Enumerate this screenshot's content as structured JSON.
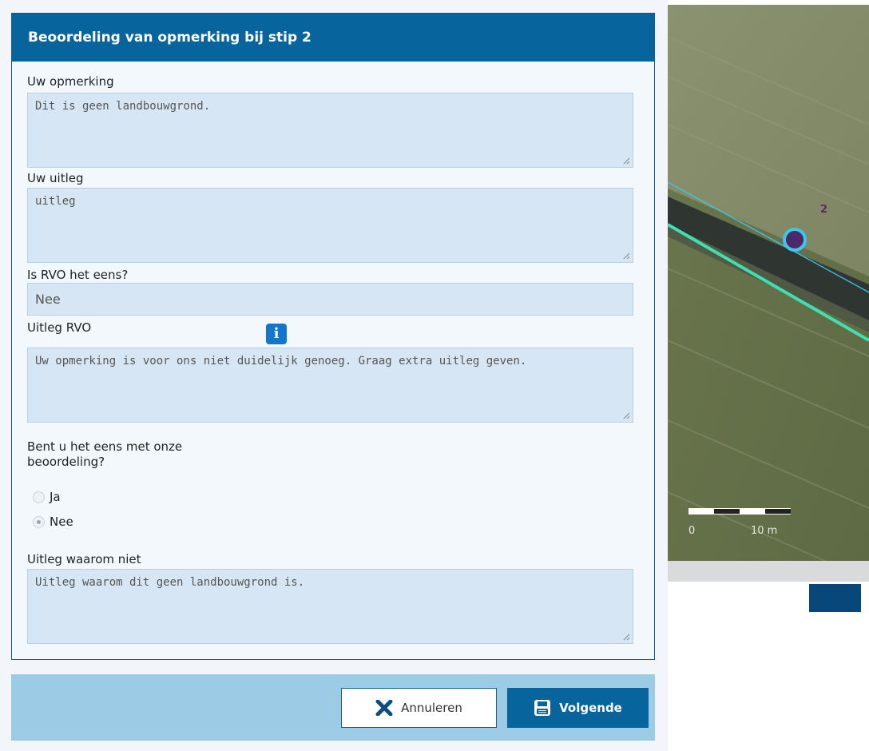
{
  "dialog": {
    "title": "Beoordeling van opmerking bij stip 2",
    "fields": {
      "remark_label": "Uw opmerking",
      "remark_value": "Dit is geen landbouwgrond.",
      "explanation_label": "Uw uitleg",
      "explanation_value": "uitleg",
      "agree_label": "Is RVO het eens?",
      "agree_value": "Nee",
      "rvo_explanation_label": "Uitleg RVO",
      "rvo_explanation_value": "Uw opmerking is voor ons niet duidelijk genoeg. Graag extra uitleg geven.",
      "question_line1": "Bent u het eens met onze",
      "question_line2": "beoordeling?",
      "why_not_label": "Uitleg waarom niet",
      "why_not_value": "Uitleg waarom dit geen landbouwgrond is."
    },
    "radio": {
      "options": [
        "Ja",
        "Nee"
      ],
      "selected": "Nee"
    },
    "info_icon_glyph": "i"
  },
  "footer": {
    "cancel_label": "Annuleren",
    "next_label": "Volgende"
  },
  "map": {
    "marker_label": "2",
    "scale_start": "0",
    "scale_end": "10 m"
  },
  "colors": {
    "header_bg": "#07649c",
    "field_bg": "#d6e6f4",
    "footer_bg": "#9ccbe6",
    "primary_button": "#07649c",
    "marker_fill": "#4a2a6a",
    "marker_outline": "#3fc6e8",
    "parcel_line": "#3fe0b0"
  },
  "icons": {
    "cancel": "close-x-icon",
    "next": "save-disk-icon",
    "info": "info-icon"
  }
}
